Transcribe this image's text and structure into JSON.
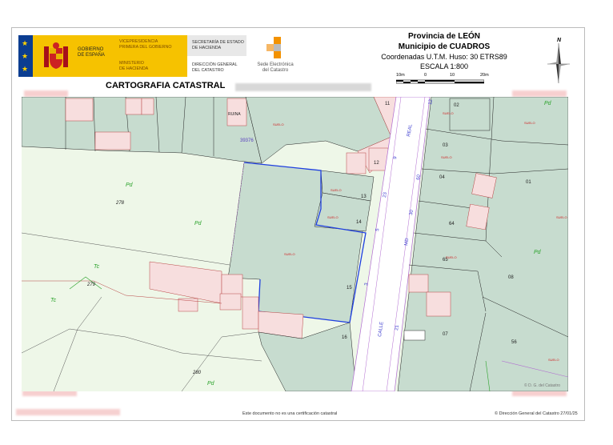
{
  "header": {
    "gobierno_line1": "GOBIERNO",
    "gobierno_line2": "DE ESPAÑA",
    "vice_line1": "VICEPRESIDENCIA",
    "vice_line2": "PRIMERA DEL GOBIERNO",
    "ministerio_line1": "MINISTERIO",
    "ministerio_line2": "DE HACIENDA",
    "secretaria_line1": "SECRETARÍA DE ESTADO",
    "secretaria_line2": "DE HACIENDA",
    "direccion_line1": "DIRECCIÓN GENERAL",
    "direccion_line2": "DEL CATASTRO",
    "sede_line1": "Sede Electrónica",
    "sede_line2": "del Catastro",
    "cartografia_title": "CARTOGRAFIA CATASTRAL"
  },
  "location": {
    "provincia": "Provincia de LEÓN",
    "municipio": "Municipio de CUADROS",
    "coordenadas": "Coordenadas U.T.M. Huso: 30 ETRS89",
    "escala": "ESCALA 1:800",
    "scale_ticks": [
      "10m",
      "0",
      "10",
      "20m"
    ]
  },
  "compass": {
    "north_label": "N"
  },
  "map": {
    "parcel_numbers": [
      "11",
      "12",
      "13",
      "14",
      "15",
      "16",
      "02",
      "03",
      "04",
      "64",
      "65",
      "08",
      "07",
      "56",
      "01",
      "278",
      "279",
      "280",
      "01"
    ],
    "labels": {
      "ruina": "RUINA",
      "poligono": "39376",
      "real": "REAL",
      "calle": "CALLE",
      "pa": "Pd",
      "tc": "Tc",
      "suelo": "SUELO",
      "copyright_map": "© D. G. del Catastro"
    },
    "street_numbers": [
      "9",
      "23",
      "5",
      "3",
      "21",
      "12",
      "60",
      "30",
      "MD"
    ],
    "colors": {
      "parcel_fill": "#c7dccf",
      "parcel_stroke": "#222222",
      "building_fill": "#f7dede",
      "building_stroke": "#b84444",
      "road_stroke": "#b06ad0",
      "highlight_stroke": "#1f3fe0",
      "rustic_fill": "#eef7e8",
      "green_text": "#2aa22a"
    }
  },
  "footer": {
    "disclaimer": "Este documento no es una certificación catastral",
    "copyright": "© Dirección General del Catastro 27/01/25"
  }
}
